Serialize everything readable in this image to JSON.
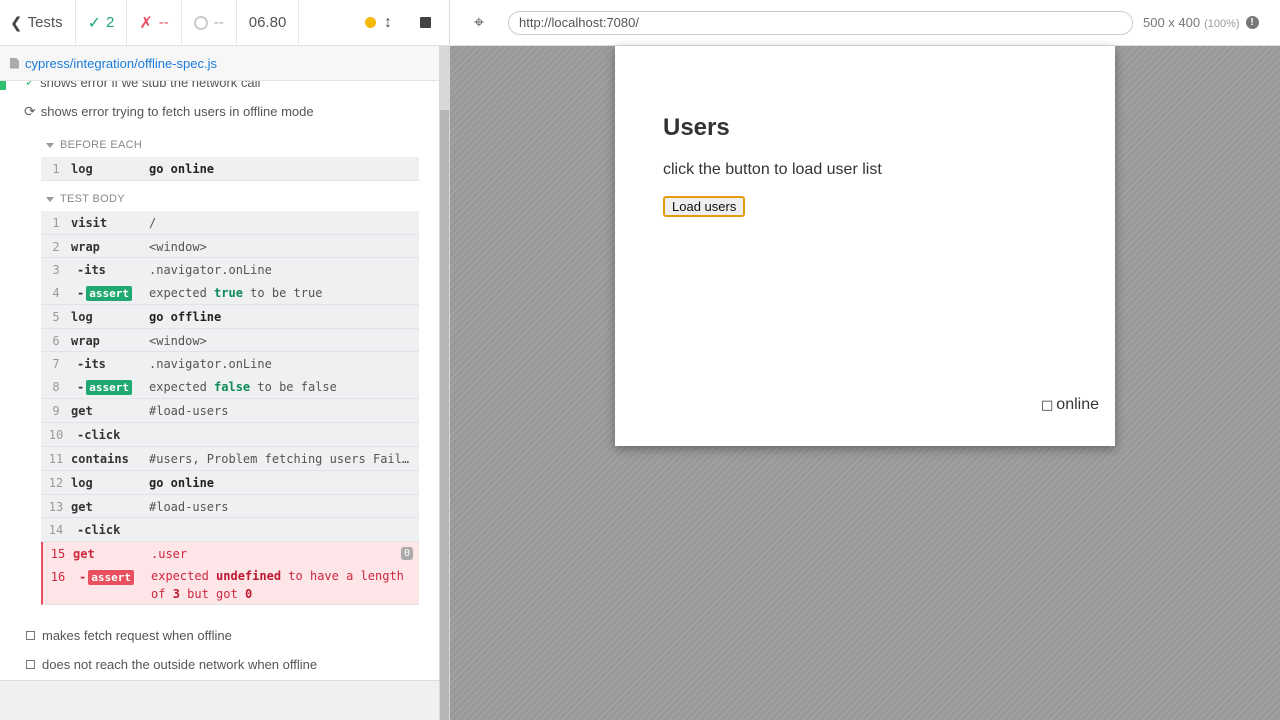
{
  "stats": {
    "tests_label": "Tests",
    "passed": "2",
    "failed": "--",
    "pending": "--",
    "duration": "06.80"
  },
  "spec": {
    "path": "cypress/integration/offline-spec.js"
  },
  "tests": [
    {
      "title": "shows error if we stub the network call",
      "state": "passed"
    },
    {
      "title": "shows error trying to fetch users in offline mode",
      "state": "running"
    },
    {
      "title": "makes fetch request when offline",
      "state": "pending"
    },
    {
      "title": "does not reach the outside network when offline",
      "state": "pending"
    }
  ],
  "hooks": {
    "before_each": "BEFORE EACH",
    "test_body": "TEST BODY"
  },
  "before_each_cmds": [
    {
      "num": "1",
      "name": "log",
      "msg": "go online"
    }
  ],
  "body_cmds": [
    {
      "num": "1",
      "name": "visit",
      "msg": "/"
    },
    {
      "num": "2",
      "name": "wrap",
      "msg": "<window>"
    },
    {
      "num": "3",
      "name": "-its",
      "msg": ".navigator.onLine"
    },
    {
      "num": "4",
      "name": "assert",
      "msg_pre": "expected",
      "msg_val": "true",
      "msg_post": "to be true"
    },
    {
      "num": "5",
      "name": "log",
      "msg": "go offline"
    },
    {
      "num": "6",
      "name": "wrap",
      "msg": "<window>"
    },
    {
      "num": "7",
      "name": "-its",
      "msg": ".navigator.onLine"
    },
    {
      "num": "8",
      "name": "assert",
      "msg_pre": "expected",
      "msg_val": "false",
      "msg_post": "to be false"
    },
    {
      "num": "9",
      "name": "get",
      "msg": "#load-users"
    },
    {
      "num": "10",
      "name": "-click",
      "msg": ""
    },
    {
      "num": "11",
      "name": "contains",
      "msg": "#users, Problem fetching users Failed to fetch"
    },
    {
      "num": "12",
      "name": "log",
      "msg": "go online"
    },
    {
      "num": "13",
      "name": "get",
      "msg": "#load-users"
    },
    {
      "num": "14",
      "name": "-click",
      "msg": ""
    },
    {
      "num": "15",
      "name": "get",
      "msg": ".user",
      "count": "0"
    },
    {
      "num": "16",
      "name": "assert",
      "msg_pre": "expected",
      "msg_val": "undefined",
      "msg_mid": "to have a length of",
      "msg_val2": "3",
      "msg_mid2": "but got",
      "msg_val3": "0"
    }
  ],
  "browser": {
    "url": "http://localhost:7080/",
    "viewport": "500 x 400",
    "zoom": "(100%)"
  },
  "app": {
    "heading": "Users",
    "instructions": "click the button to load user list",
    "button_label": "Load users",
    "status": "online"
  },
  "colors": {
    "pass": "#1fa971",
    "fail": "#e94f5f",
    "accent": "#1a7bdc",
    "focus": "#e59b0c"
  }
}
